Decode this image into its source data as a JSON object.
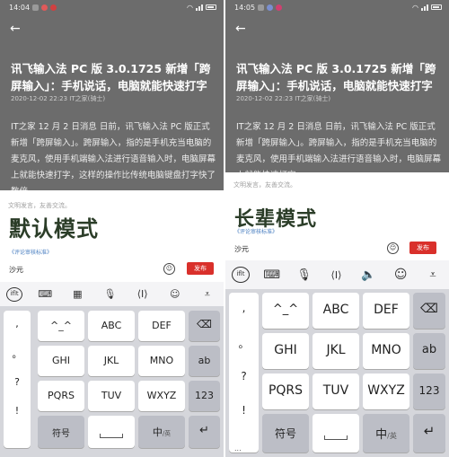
{
  "panels": [
    {
      "id": "left",
      "status": {
        "time": "14:04",
        "battery": ""
      },
      "article": {
        "title": "讯飞输入法 PC 版 3.0.1725 新增「跨屏输入」：手机说话，电脑就能快速打字",
        "meta": "2020-12-02 22:23 IT之家(骑士)",
        "body": "IT之家 12 月 2 日消息 日前，讯飞输入法 PC 版正式新增「跨屏输入」。跨屏输入，指的是手机充当电脑的麦克风，使用手机端输入法进行语音输入时，电脑屏幕上就能快速打字，这样的操作比传统电脑键盘打字快了数倍。"
      },
      "comment": {
        "hint": "文明发言，友善交流。",
        "mode_label": "默认模式",
        "rules_link": "《评论审核标准》",
        "input_value": "沙元",
        "publish_label": "发布"
      },
      "keyboard": {
        "punctuation": [
          ",",
          "。",
          "?",
          "!"
        ],
        "keys": [
          {
            "sym": "",
            "label": "^_^"
          },
          {
            "sym": "",
            "label": "ABC"
          },
          {
            "sym": "",
            "label": "DEF"
          },
          {
            "sym": "",
            "label": "GHI"
          },
          {
            "sym": "",
            "label": "JKL"
          },
          {
            "sym": "",
            "label": "MNO"
          },
          {
            "sym": "",
            "label": "PQRS"
          },
          {
            "sym": "",
            "label": "TUV"
          },
          {
            "sym": "",
            "label": "WXYZ"
          }
        ],
        "side_keys": {
          "delete": "⌫",
          "ab": "ab",
          "num": "123",
          "enter": "↵"
        },
        "bottom": {
          "symbols": "符号",
          "lang_main": "中",
          "lang_sub": "/英",
          "more": "..."
        }
      }
    },
    {
      "id": "right",
      "status": {
        "time": "14:05",
        "battery": ""
      },
      "article": {
        "title": "讯飞输入法 PC 版 3.0.1725 新增「跨屏输入」：手机说话，电脑就能快速打字",
        "meta": "2020-12-02 22:23 IT之家(骑士)",
        "body": "IT之家 12 月 2 日消息 日前，讯飞输入法 PC 版正式新增「跨屏输入」。跨屏输入，指的是手机充当电脑的麦克风，使用手机端输入法进行语音输入时，电脑屏幕上就能快速打字。"
      },
      "comment": {
        "hint": "文明发言，友善交流。",
        "mode_label": "长辈模式",
        "rules_link": "《评论审核标准》",
        "input_value": "沙元",
        "publish_label": "发布"
      },
      "keyboard": {
        "punctuation": [
          ",",
          "。",
          "?",
          "!"
        ],
        "keys": [
          {
            "sym": "",
            "label": "^_^"
          },
          {
            "sym": "",
            "label": "ABC"
          },
          {
            "sym": "",
            "label": "DEF"
          },
          {
            "sym": "",
            "label": "GHI"
          },
          {
            "sym": "",
            "label": "JKL"
          },
          {
            "sym": "",
            "label": "MNO"
          },
          {
            "sym": "",
            "label": "PQRS"
          },
          {
            "sym": "",
            "label": "TUV"
          },
          {
            "sym": "",
            "label": "WXYZ"
          }
        ],
        "side_keys": {
          "delete": "⌫",
          "ab": "ab",
          "num": "123",
          "enter": "↵"
        },
        "bottom": {
          "symbols": "符号",
          "lang_main": "中",
          "lang_sub": "/英",
          "more": "..."
        }
      }
    }
  ],
  "icons": {
    "toolbar": [
      "ime-logo-icon",
      "keyboard-icon",
      "microphone-icon",
      "cursor-move-icon",
      "emoji-icon",
      "collapse-icon"
    ],
    "right_toolbar": [
      "ime-logo-icon",
      "keyboard-icon",
      "microphone-icon",
      "cursor-move-icon",
      "speaker-icon",
      "emoji-icon",
      "collapse-icon"
    ]
  },
  "colors": {
    "dim_overlay": "#6c6c6c",
    "publish_red": "#d9302b",
    "mode_label": "#2b3d28",
    "keyboard_bg": "#d5d6db",
    "function_key": "#bcbec6"
  }
}
